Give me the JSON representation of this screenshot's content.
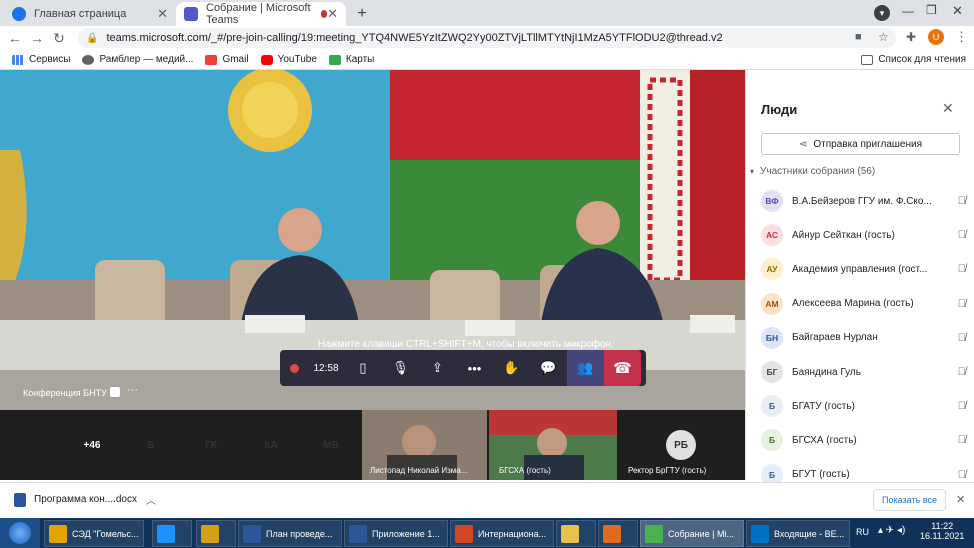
{
  "browser": {
    "tabs": [
      {
        "title": "Главная страница",
        "icon": "globe-icon"
      },
      {
        "title": "Собрание | Microsoft Teams",
        "icon": "teams-icon"
      }
    ],
    "new_tab": "+",
    "url": "teams.microsoft.com/_#/pre-join-calling/19:meeting_YTQ4NWE5YzItZWQ2Yy00ZTVjLTllMTYtNjI1MzA5YTFlODU2@thread.v2",
    "profile_initial": "U",
    "bookmarks": [
      {
        "label": "Сервисы",
        "icon": "apps-icon"
      },
      {
        "label": "Рамблер — медий...",
        "icon": "rambler-icon"
      },
      {
        "label": "Gmail",
        "icon": "gmail-icon"
      },
      {
        "label": "YouTube",
        "icon": "youtube-icon"
      },
      {
        "label": "Карты",
        "icon": "maps-icon"
      }
    ],
    "reading_list": "Список для чтения"
  },
  "meeting": {
    "caption": "Нажмите клавиши CTRL+SHIFT+M, чтобы включить микрофон.",
    "presenter_label": "Конференция БНТУ",
    "timer": "12:58",
    "strip_avatars": [
      {
        "initials": "+46",
        "color": "#4f52b2"
      },
      {
        "initials": "Б",
        "color": "#e8e1d0"
      },
      {
        "initials": "ГК",
        "color": "#f4d5d5"
      },
      {
        "initials": "КА",
        "color": "#fbe6c4"
      },
      {
        "initials": "МВ",
        "color": "#dbe9d3"
      }
    ],
    "video_tiles": [
      {
        "name": "Листопад Николай Изма..."
      },
      {
        "name": "БГСХА (гость)"
      }
    ],
    "rb_tile": {
      "initials": "РБ",
      "name": "Ректор БрГТУ (гость)"
    }
  },
  "panel": {
    "title": "Люди",
    "invite_button": "Отправка приглашения",
    "section_label": "Участники собрания (56)",
    "participants": [
      {
        "initials": "ВФ",
        "name": "В.А.Бейзеров ГГУ им. Ф.Ско...",
        "bg": "#e3e0f3",
        "fg": "#4f52b2"
      },
      {
        "initials": "АС",
        "name": "Айнур Сейткан (гость)",
        "bg": "#fbe0e0",
        "fg": "#c4314b"
      },
      {
        "initials": "АУ",
        "name": "Академия управления (гост...",
        "bg": "#fbf0c8",
        "fg": "#8a6d00"
      },
      {
        "initials": "АМ",
        "name": "Алексеева Марина (гость)",
        "bg": "#fbe3c9",
        "fg": "#a0531b"
      },
      {
        "initials": "БН",
        "name": "Байгараев Нурлан",
        "bg": "#dce5f4",
        "fg": "#2e5494"
      },
      {
        "initials": "БГ",
        "name": "Баяндина Гуль",
        "bg": "#e4e4e4",
        "fg": "#444"
      },
      {
        "initials": "Б",
        "name": "БГАТУ (гость)",
        "bg": "#e8eef4",
        "fg": "#3f5a78"
      },
      {
        "initials": "Б",
        "name": "БГСХА (гость)",
        "bg": "#e7f2de",
        "fg": "#4a6f2d"
      },
      {
        "initials": "Б",
        "name": "БГУТ (гость)",
        "bg": "#e3eef8",
        "fg": "#2e5f8a"
      }
    ]
  },
  "download": {
    "file": "Программа кон....docx",
    "show_all": "Показать все"
  },
  "taskbar": {
    "items": [
      {
        "label": "СЭД \"Гомельс...",
        "icon": "1c-icon",
        "color": "#e2a400"
      },
      {
        "label": "",
        "icon": "ie-icon",
        "color": "#1e90ff"
      },
      {
        "label": "",
        "icon": "app-icon",
        "color": "#d4a017"
      },
      {
        "label": "План проведе...",
        "icon": "word-icon",
        "color": "#2b579a"
      },
      {
        "label": "Приложение 1...",
        "icon": "word-icon",
        "color": "#2b579a"
      },
      {
        "label": "Интернациона...",
        "icon": "powerpoint-icon",
        "color": "#d24726"
      },
      {
        "label": "",
        "icon": "folder-icon",
        "color": "#e8c14b"
      },
      {
        "label": "",
        "icon": "media-icon",
        "color": "#e06c1f"
      },
      {
        "label": "Собрание | Mi...",
        "icon": "chrome-icon",
        "color": "#4caf50"
      },
      {
        "label": "Входящие - ВЕ...",
        "icon": "outlook-icon",
        "color": "#0072c6"
      }
    ],
    "lang": "RU",
    "time": "11:22",
    "date": "16.11.2021"
  }
}
